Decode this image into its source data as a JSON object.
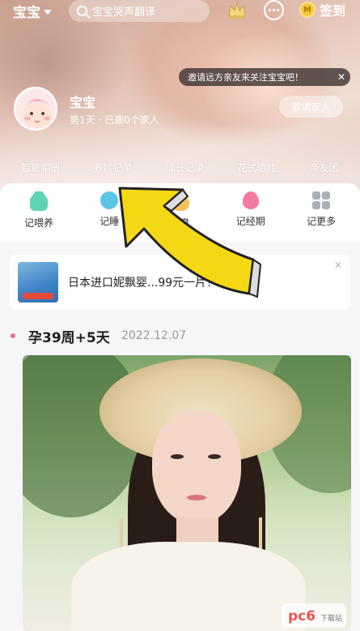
{
  "topbar": {
    "baby_switch_label": "宝宝",
    "search_placeholder": "宝宝哭声翻译",
    "vip_icon": "crown-icon",
    "more_icon": "more-dots-icon",
    "signin_label": "签到",
    "coin_letter": "M"
  },
  "invite_tip": {
    "text": "邀请远方亲友来关注宝宝吧！",
    "close_label": "✕"
  },
  "profile": {
    "name": "宝宝",
    "meta": "第1天 · 已邀0个家人",
    "invite_button": "邀请家人"
  },
  "tabs": [
    "智能相册",
    "养娃记录",
    "成长记录",
    "花式晒娃",
    "亲友团"
  ],
  "quick_actions": [
    {
      "label": "记喂养",
      "icon": "bottle-icon"
    },
    {
      "label": "记睡",
      "icon": "sleep-icon"
    },
    {
      "label": "记臭",
      "icon": "poop-icon"
    },
    {
      "label": "记经期",
      "icon": "drop-icon"
    },
    {
      "label": "记更多",
      "icon": "grid-icon"
    }
  ],
  "ad": {
    "text": "日本进口妮飘婴...99元一片！",
    "close_label": "✕"
  },
  "timeline": {
    "week": "孕39周+5天",
    "date": "2022.12.07"
  },
  "watermark": {
    "brand": "pc6",
    "sub": "下载站"
  },
  "colors": {
    "accent_pink": "#f06b9a",
    "arrow_yellow": "#f5d814"
  }
}
